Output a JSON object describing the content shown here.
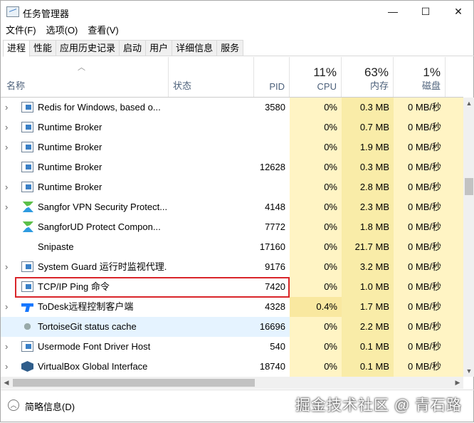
{
  "window": {
    "title": "任务管理器",
    "minimize": "—",
    "maximize": "☐",
    "close": "✕"
  },
  "menu": [
    "文件(F)",
    "选项(O)",
    "查看(V)"
  ],
  "tabs": [
    "进程",
    "性能",
    "应用历史记录",
    "启动",
    "用户",
    "详细信息",
    "服务"
  ],
  "columns": {
    "name": "名称",
    "status": "状态",
    "pid": "PID",
    "cpu": "CPU",
    "cpu_pct": "11%",
    "mem": "内存",
    "mem_pct": "63%",
    "disk": "磁盘",
    "disk_pct": "1%"
  },
  "rows": [
    {
      "name": "Redis for Windows, based o...",
      "pid": "3580",
      "cpu": "0%",
      "mem": "0.3 MB",
      "disk": "0 MB/秒",
      "exp": "›"
    },
    {
      "name": "Runtime Broker",
      "pid": "",
      "cpu": "0%",
      "mem": "0.7 MB",
      "disk": "0 MB/秒",
      "exp": "›"
    },
    {
      "name": "Runtime Broker",
      "pid": "",
      "cpu": "0%",
      "mem": "1.9 MB",
      "disk": "0 MB/秒",
      "exp": "›"
    },
    {
      "name": "Runtime Broker",
      "pid": "12628",
      "cpu": "0%",
      "mem": "0.3 MB",
      "disk": "0 MB/秒",
      "exp": ""
    },
    {
      "name": "Runtime Broker",
      "pid": "",
      "cpu": "0%",
      "mem": "2.8 MB",
      "disk": "0 MB/秒",
      "exp": "›"
    },
    {
      "name": "Sangfor VPN Security Protect...",
      "pid": "4148",
      "cpu": "0%",
      "mem": "2.3 MB",
      "disk": "0 MB/秒",
      "exp": "›"
    },
    {
      "name": "SangforUD Protect Compon...",
      "pid": "7772",
      "cpu": "0%",
      "mem": "1.8 MB",
      "disk": "0 MB/秒",
      "exp": ""
    },
    {
      "name": "Snipaste",
      "pid": "17160",
      "cpu": "0%",
      "mem": "21.7 MB",
      "disk": "0 MB/秒",
      "exp": ""
    },
    {
      "name": "System Guard 运行时监视代理...",
      "pid": "9176",
      "cpu": "0%",
      "mem": "3.2 MB",
      "disk": "0 MB/秒",
      "exp": "›"
    },
    {
      "name": "TCP/IP Ping 命令",
      "pid": "7420",
      "cpu": "0%",
      "mem": "1.0 MB",
      "disk": "0 MB/秒",
      "exp": ""
    },
    {
      "name": "ToDesk远程控制客户端",
      "pid": "4328",
      "cpu": "0.4%",
      "mem": "1.7 MB",
      "disk": "0 MB/秒",
      "exp": "›"
    },
    {
      "name": "TortoiseGit status cache",
      "pid": "16696",
      "cpu": "0%",
      "mem": "2.2 MB",
      "disk": "0 MB/秒",
      "exp": ""
    },
    {
      "name": "Usermode Font Driver Host",
      "pid": "540",
      "cpu": "0%",
      "mem": "0.1 MB",
      "disk": "0 MB/秒",
      "exp": "›"
    },
    {
      "name": "VirtualBox Global Interface",
      "pid": "18740",
      "cpu": "0%",
      "mem": "0.1 MB",
      "disk": "0 MB/秒",
      "exp": "›"
    }
  ],
  "footer": {
    "fewer_details": "简略信息(D)",
    "watermark": "掘金技术社区 @ 青石路"
  },
  "colors": {
    "highlight": "#d9252a",
    "cpu_bg": "#fff4c4",
    "mem_bg": "#f9eca8"
  }
}
